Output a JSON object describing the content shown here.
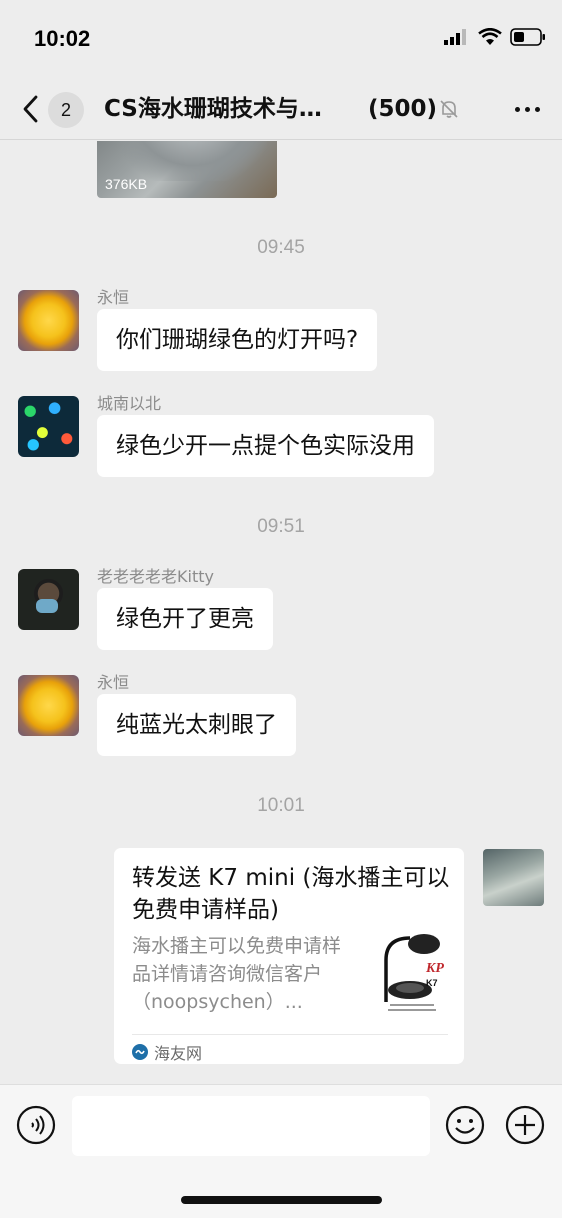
{
  "status": {
    "time": "10:02"
  },
  "header": {
    "unread_count": "2",
    "title": "CS海水珊瑚技术与…",
    "member_count": "(500)"
  },
  "messages": {
    "image_size": "376KB",
    "ts1": "09:45",
    "m1": {
      "sender": "永恒",
      "text": "你们珊瑚绿色的灯开吗?"
    },
    "m2": {
      "sender": "城南以北",
      "text": "绿色少开一点提个色实际没用"
    },
    "ts2": "09:51",
    "m3": {
      "sender": "老老老老老Kitty",
      "text": "绿色开了更亮"
    },
    "m4": {
      "sender": "永恒",
      "text": "纯蓝光太刺眼了"
    },
    "ts3": "10:01",
    "card": {
      "title": "转发送 K7 mini (海水播主可以免费申请样品)",
      "description": "海水播主可以免费申请样品详情请咨询微信客户（noopsychen）...",
      "source": "海友网",
      "thumb_brand": "KP",
      "thumb_model": "K7"
    }
  },
  "colors": {
    "background": "#ededed",
    "bubble": "#ffffff",
    "timestamp": "#a4a4a4"
  },
  "icons": [
    "back-arrow-icon",
    "mute-bell-icon",
    "more-icon",
    "voice-icon",
    "emoji-icon",
    "plus-icon"
  ]
}
